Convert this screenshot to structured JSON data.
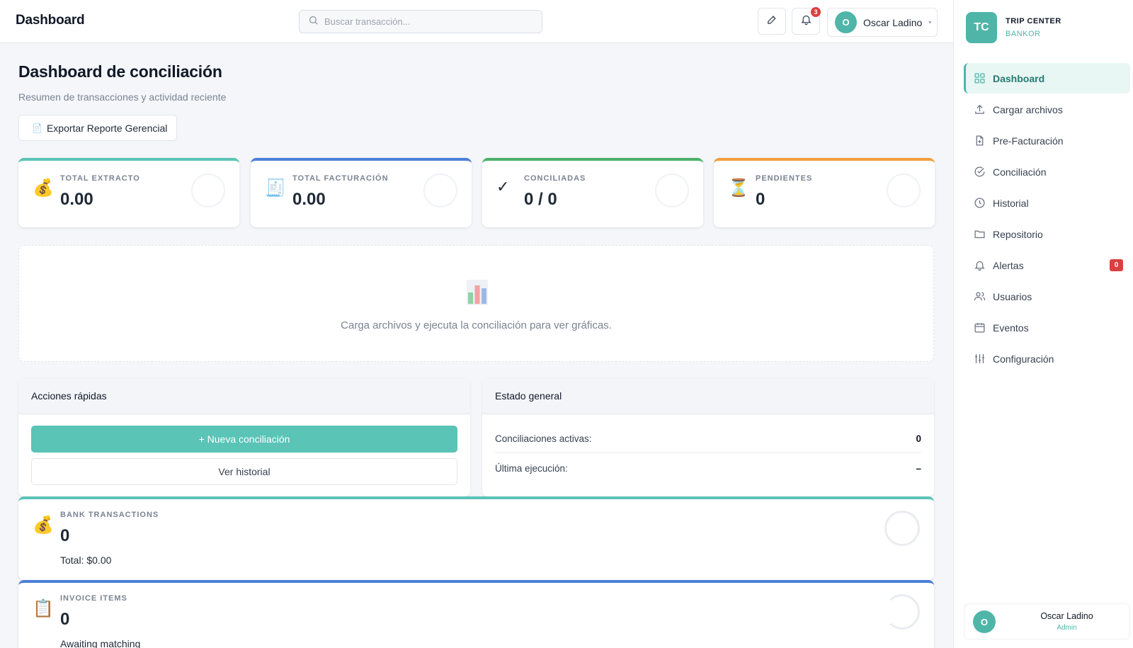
{
  "header": {
    "title": "Dashboard",
    "search_placeholder": "Buscar transacción...",
    "notifications_count": "3",
    "user_initial": "O",
    "user_name": "Oscar Ladino"
  },
  "main": {
    "title": "Dashboard de conciliación",
    "subtitle": "Resumen de transacciones y actividad reciente",
    "export_label": "Exportar Reporte Gerencial",
    "stats": [
      {
        "label": "TOTAL EXTRACTO",
        "value": "0.00",
        "icon": "money-bag-icon",
        "color": "#5ac4b7"
      },
      {
        "label": "TOTAL FACTURACIÓN",
        "value": "0.00",
        "icon": "receipt-icon",
        "color": "#4a7fd8"
      },
      {
        "label": "CONCILIADAS",
        "value": "0 / 0",
        "icon": "check-icon",
        "color": "#4caf6a"
      },
      {
        "label": "PENDIENTES",
        "value": "0",
        "icon": "hourglass-icon",
        "color": "#f0a03c"
      }
    ],
    "empty_chart_message": "Carga archivos y ejecuta la conciliación para ver gráficas.",
    "quick_actions": {
      "title": "Acciones rápidas",
      "primary_label": "+ Nueva conciliación",
      "secondary_label": "Ver historial"
    },
    "general_status": {
      "title": "Estado general",
      "rows": [
        {
          "label": "Conciliaciones activas:",
          "value": "0"
        },
        {
          "label": "Última ejecución:",
          "value": "–"
        }
      ]
    },
    "bank_card": {
      "label": "BANK TRANSACTIONS",
      "value": "0",
      "sub": "Total: $0.00",
      "color": "#5ac4b7"
    },
    "invoice_card": {
      "label": "INVOICE ITEMS",
      "value": "0",
      "sub": "Awaiting matching",
      "color": "#4a7fd8"
    }
  },
  "sidebar": {
    "logo_initials": "TC",
    "company": "TRIP CENTER",
    "product": "BANKOR",
    "items": [
      {
        "label": "Dashboard",
        "icon": "grid-icon"
      },
      {
        "label": "Cargar archivos",
        "icon": "upload-icon"
      },
      {
        "label": "Pre-Facturación",
        "icon": "file-plus-icon"
      },
      {
        "label": "Conciliación",
        "icon": "check-circle-icon"
      },
      {
        "label": "Historial",
        "icon": "clock-icon"
      },
      {
        "label": "Repositorio",
        "icon": "folder-icon"
      },
      {
        "label": "Alertas",
        "icon": "bell-icon",
        "badge": "0"
      },
      {
        "label": "Usuarios",
        "icon": "users-icon"
      },
      {
        "label": "Eventos",
        "icon": "calendar-icon"
      },
      {
        "label": "Configuración",
        "icon": "sliders-icon"
      }
    ],
    "user_initial": "O",
    "user_name": "Oscar Ladino",
    "user_role": "Admin"
  },
  "colors": {
    "accent": "#5ac4b7",
    "danger": "#dc3f3f",
    "blue": "#4a7fd8",
    "green": "#4caf6a",
    "orange": "#f0a03c"
  }
}
